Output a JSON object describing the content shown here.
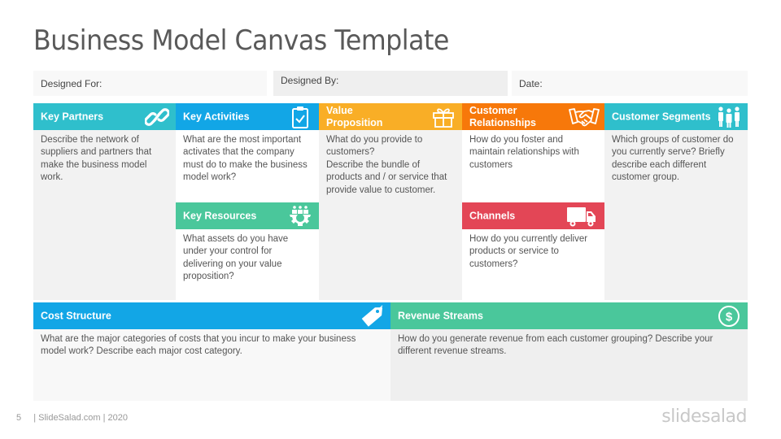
{
  "title": "Business Model Canvas Template",
  "meta": {
    "designed_for": "Designed For:",
    "designed_by": "Designed By:",
    "date": "Date:"
  },
  "colors": {
    "teal": "#2fbfcc",
    "blue": "#12a6e6",
    "yellow": "#f9ae26",
    "orange": "#f7780a",
    "green": "#4ac79b",
    "red": "#e34656",
    "cyan": "#2fbfcc"
  },
  "blocks": {
    "key_partners": {
      "title": "Key Partners",
      "icon": "link-icon",
      "text": "Describe the network of suppliers and partners that make the business model work."
    },
    "key_activities": {
      "title": "Key Activities",
      "icon": "clipboard-check-icon",
      "text": "What are the most important activates that the company must do to make the business model work?"
    },
    "key_resources": {
      "title": "Key Resources",
      "icon": "gear-people-icon",
      "text": "What assets do you have under your control for delivering on your value proposition?"
    },
    "value_proposition": {
      "title": "Value Proposition",
      "icon": "gift-icon",
      "text": "What do you provide to customers?\nDescribe the bundle of products and / or service that provide value to customer."
    },
    "customer_relationships": {
      "title": "Customer Relationships",
      "icon": "handshake-icon",
      "text": "How do you foster and maintain relationships with customers"
    },
    "channels": {
      "title": "Channels",
      "icon": "truck-icon",
      "text": "How do you currently deliver products or service to customers?"
    },
    "customer_segments": {
      "title": "Customer Segments",
      "icon": "people-group-icon",
      "text": "Which groups of customer do you currently serve? Briefly describe each different customer group."
    },
    "cost_structure": {
      "title": "Cost Structure",
      "icon": "price-tag-icon",
      "text": "What are the major categories of costs that you incur to make your business model work? Describe each major cost category."
    },
    "revenue_streams": {
      "title": "Revenue Streams",
      "icon": "dollar-circle-icon",
      "text": "How do you generate revenue from each customer grouping? Describe your different revenue streams."
    }
  },
  "footer": {
    "page_number": "5",
    "credit": "| SlideSalad.com | 2020",
    "logo": "slidesalad"
  }
}
